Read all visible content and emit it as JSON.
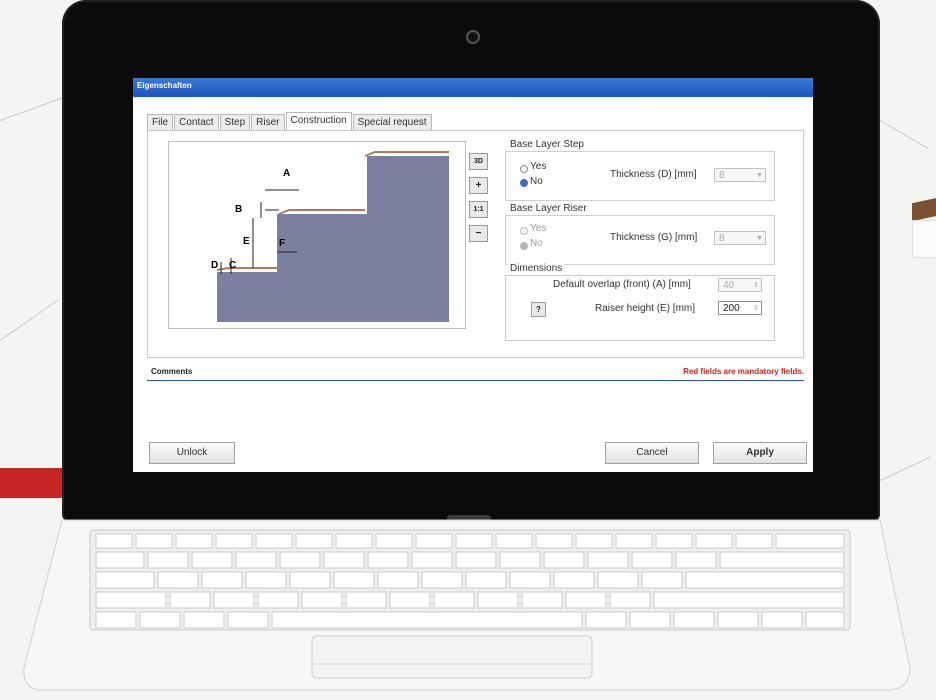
{
  "window": {
    "title": "Eigenschaften"
  },
  "tabs": [
    "File",
    "Contact",
    "Step",
    "Riser",
    "Construction",
    "Special request"
  ],
  "active_tab": "Construction",
  "diagram": {
    "labels": [
      "A",
      "B",
      "C",
      "D",
      "E",
      "F"
    ]
  },
  "tools": [
    "3D",
    "+",
    "1:1",
    "−"
  ],
  "base_layer_step": {
    "title": "Base Layer Step",
    "yes": "Yes",
    "no": "No",
    "selected": "No",
    "thickness_label": "Thickness (D) [mm]",
    "thickness_value": "8"
  },
  "base_layer_riser": {
    "title": "Base Layer Riser",
    "yes": "Yes",
    "no": "No",
    "selected": "No",
    "thickness_label": "Thickness (G) [mm]",
    "thickness_value": "8"
  },
  "dimensions": {
    "title": "Dimensions",
    "overlap_label": "Default overlap (front) (A) [mm]",
    "overlap_value": "40",
    "riser_label": "Raiser height (E) [mm]",
    "riser_value": "200",
    "question_button": "?"
  },
  "comments": {
    "title": "Comments",
    "mandatory_note": "Red fields are mandatory fields."
  },
  "buttons": {
    "unlock": "Unlock",
    "cancel": "Cancel",
    "apply": "Apply"
  },
  "colors": {
    "titlebar": "#2a63c8",
    "stair_fill": "#7d7fa0",
    "stair_edge": "#b07a5a",
    "mandatory": "#d42020",
    "accent_red": "#c82626"
  }
}
